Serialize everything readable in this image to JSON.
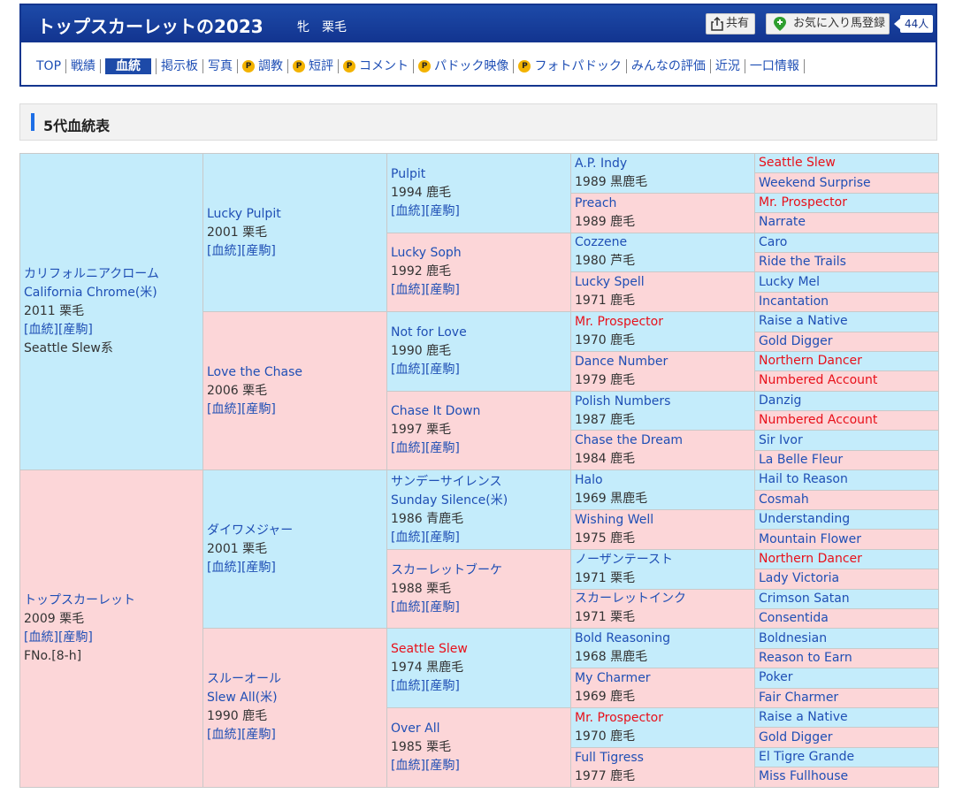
{
  "header": {
    "horse_name": "トップスカーレットの2023",
    "horse_info": "牝　栗毛",
    "share_label": "共有",
    "favorite_label": "お気に入り馬登録",
    "favorite_count": "44人"
  },
  "nav": [
    {
      "label": "TOP",
      "p": false
    },
    {
      "label": "戦績",
      "p": false
    },
    {
      "label": "血統",
      "p": false,
      "active": true
    },
    {
      "label": "掲示板",
      "p": false
    },
    {
      "label": "写真",
      "p": false
    },
    {
      "label": "調教",
      "p": true
    },
    {
      "label": "短評",
      "p": true
    },
    {
      "label": "コメント",
      "p": true
    },
    {
      "label": "パドック映像",
      "p": true
    },
    {
      "label": "フォトパドック",
      "p": true
    },
    {
      "label": "みんなの評価",
      "p": false
    },
    {
      "label": "近況",
      "p": false
    },
    {
      "label": "一口情報",
      "p": false
    }
  ],
  "section_title": "5代血統表",
  "links": {
    "pedigree": "[血統]",
    "offspring": "[産駒]"
  },
  "pedigree": {
    "g1": [
      {
        "name": "カリフォルニアクローム",
        "name2": "California Chrome(米)",
        "year": "2011 栗毛",
        "extra": "Seattle Slew系",
        "sex": "m"
      },
      {
        "name": "トップスカーレット",
        "year": "2009 栗毛",
        "extra": "FNo.[8-h]",
        "sex": "f"
      }
    ],
    "g2": [
      {
        "name": "Lucky Pulpit",
        "year": "2001 栗毛",
        "sex": "m"
      },
      {
        "name": "Love the Chase",
        "year": "2006 栗毛",
        "sex": "f"
      },
      {
        "name": "ダイワメジャー",
        "year": "2001 栗毛",
        "sex": "m"
      },
      {
        "name": "スルーオール",
        "name2": "Slew All(米)",
        "year": "1990 鹿毛",
        "sex": "f"
      }
    ],
    "g3": [
      {
        "name": "Pulpit",
        "year": "1994 鹿毛",
        "sex": "m"
      },
      {
        "name": "Lucky Soph",
        "year": "1992 鹿毛",
        "sex": "f"
      },
      {
        "name": "Not for Love",
        "year": "1990 鹿毛",
        "sex": "m"
      },
      {
        "name": "Chase It Down",
        "year": "1997 栗毛",
        "sex": "f"
      },
      {
        "name": "サンデーサイレンス",
        "name2": "Sunday Silence(米)",
        "year": "1986 青鹿毛",
        "sex": "m"
      },
      {
        "name": "スカーレットブーケ",
        "year": "1988 栗毛",
        "sex": "f"
      },
      {
        "name": "Seattle Slew",
        "year": "1974 黒鹿毛",
        "sex": "m",
        "red": true
      },
      {
        "name": "Over All",
        "year": "1985 栗毛",
        "sex": "f"
      }
    ],
    "g4": [
      {
        "name": "A.P. Indy",
        "year": "1989 黒鹿毛",
        "sex": "m"
      },
      {
        "name": "Preach",
        "year": "1989 鹿毛",
        "sex": "f"
      },
      {
        "name": "Cozzene",
        "year": "1980 芦毛",
        "sex": "m"
      },
      {
        "name": "Lucky Spell",
        "year": "1971 鹿毛",
        "sex": "f"
      },
      {
        "name": "Mr. Prospector",
        "year": "1970 鹿毛",
        "sex": "m",
        "red": true
      },
      {
        "name": "Dance Number",
        "year": "1979 鹿毛",
        "sex": "f"
      },
      {
        "name": "Polish Numbers",
        "year": "1987 鹿毛",
        "sex": "m"
      },
      {
        "name": "Chase the Dream",
        "year": "1984 鹿毛",
        "sex": "f"
      },
      {
        "name": "Halo",
        "year": "1969 黒鹿毛",
        "sex": "m"
      },
      {
        "name": "Wishing Well",
        "year": "1975 鹿毛",
        "sex": "f"
      },
      {
        "name": "ノーザンテースト",
        "year": "1971 栗毛",
        "sex": "m"
      },
      {
        "name": "スカーレットインク",
        "year": "1971 栗毛",
        "sex": "f"
      },
      {
        "name": "Bold Reasoning",
        "year": "1968 黒鹿毛",
        "sex": "m"
      },
      {
        "name": "My Charmer",
        "year": "1969 鹿毛",
        "sex": "f"
      },
      {
        "name": "Mr. Prospector",
        "year": "1970 鹿毛",
        "sex": "m",
        "red": true
      },
      {
        "name": "Full Tigress",
        "year": "1977 鹿毛",
        "sex": "f"
      }
    ],
    "g5": [
      {
        "name": "Seattle Slew",
        "sex": "m",
        "red": true
      },
      {
        "name": "Weekend Surprise",
        "sex": "f"
      },
      {
        "name": "Mr. Prospector",
        "sex": "m",
        "red": true
      },
      {
        "name": "Narrate",
        "sex": "f"
      },
      {
        "name": "Caro",
        "sex": "m"
      },
      {
        "name": "Ride the Trails",
        "sex": "f"
      },
      {
        "name": "Lucky Mel",
        "sex": "m"
      },
      {
        "name": "Incantation",
        "sex": "f"
      },
      {
        "name": "Raise a Native",
        "sex": "m"
      },
      {
        "name": "Gold Digger",
        "sex": "f"
      },
      {
        "name": "Northern Dancer",
        "sex": "m",
        "red": true
      },
      {
        "name": "Numbered Account",
        "sex": "f",
        "red": true
      },
      {
        "name": "Danzig",
        "sex": "m"
      },
      {
        "name": "Numbered Account",
        "sex": "f",
        "red": true
      },
      {
        "name": "Sir Ivor",
        "sex": "m"
      },
      {
        "name": "La Belle Fleur",
        "sex": "f"
      },
      {
        "name": "Hail to Reason",
        "sex": "m"
      },
      {
        "name": "Cosmah",
        "sex": "f"
      },
      {
        "name": "Understanding",
        "sex": "m"
      },
      {
        "name": "Mountain Flower",
        "sex": "f"
      },
      {
        "name": "Northern Dancer",
        "sex": "m",
        "red": true
      },
      {
        "name": "Lady Victoria",
        "sex": "f"
      },
      {
        "name": "Crimson Satan",
        "sex": "m"
      },
      {
        "name": "Consentida",
        "sex": "f"
      },
      {
        "name": "Boldnesian",
        "sex": "m"
      },
      {
        "name": "Reason to Earn",
        "sex": "f"
      },
      {
        "name": "Poker",
        "sex": "m"
      },
      {
        "name": "Fair Charmer",
        "sex": "f"
      },
      {
        "name": "Raise a Native",
        "sex": "m"
      },
      {
        "name": "Gold Digger",
        "sex": "f"
      },
      {
        "name": "El Tigre Grande",
        "sex": "m"
      },
      {
        "name": "Miss Fullhouse",
        "sex": "f"
      }
    ]
  },
  "colors": {
    "header_blue": "#12348f",
    "male_bg": "#c4ecfb",
    "female_bg": "#fcd6d8",
    "link": "#1f4fb5",
    "highlight": "#e8101a",
    "accent": "#1d6ee6"
  }
}
